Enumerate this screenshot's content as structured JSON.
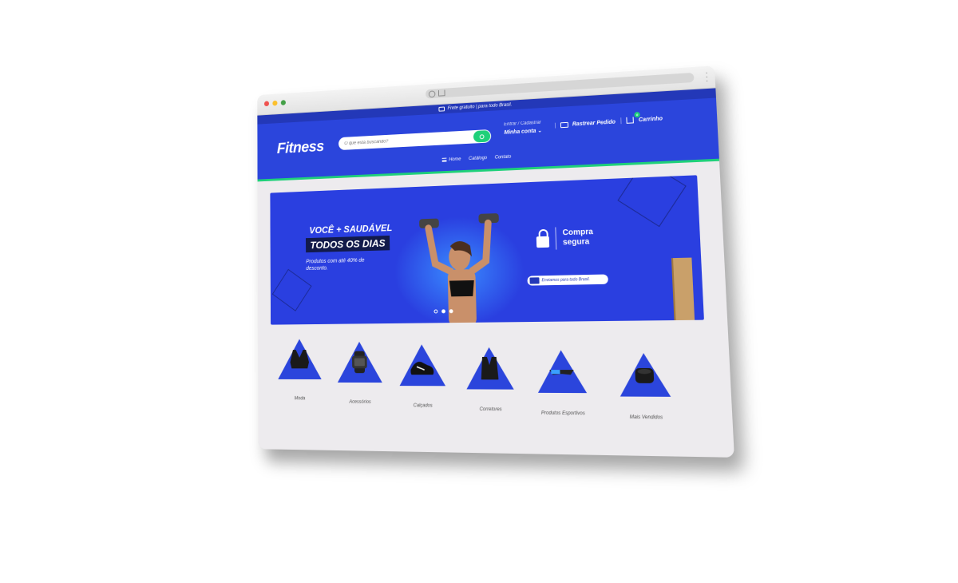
{
  "topbar": {
    "text": "Frete gratuito | para todo Brasil."
  },
  "header": {
    "logo": "Fitness",
    "search_placeholder": "O que está buscando?",
    "account_small": "Entrar / Cadastrar",
    "account_big": "Minha conta",
    "track_label": "Rastrear Pedido",
    "cart_label": "Carrinho",
    "cart_count": "0"
  },
  "nav": {
    "items": [
      "Home",
      "Catálogo",
      "Contato"
    ]
  },
  "banner": {
    "headline1": "VOCÊ + SAUDÁVEL",
    "headline2": "TODOS OS DIAS",
    "subtitle": "Produtos com até 40% de desconto.",
    "secure_line1": "Compra",
    "secure_line2": "segura",
    "shipping_pill": "Enviamos para todo Brasil."
  },
  "categories": [
    "Moda",
    "Acessórios",
    "Calçados",
    "Corretores",
    "Produtos Esportivos",
    "Mais Vendidos"
  ],
  "colors": {
    "brand_blue": "#2b45dc",
    "accent_green": "#1fd07a",
    "dark_blue": "#121a4a"
  }
}
